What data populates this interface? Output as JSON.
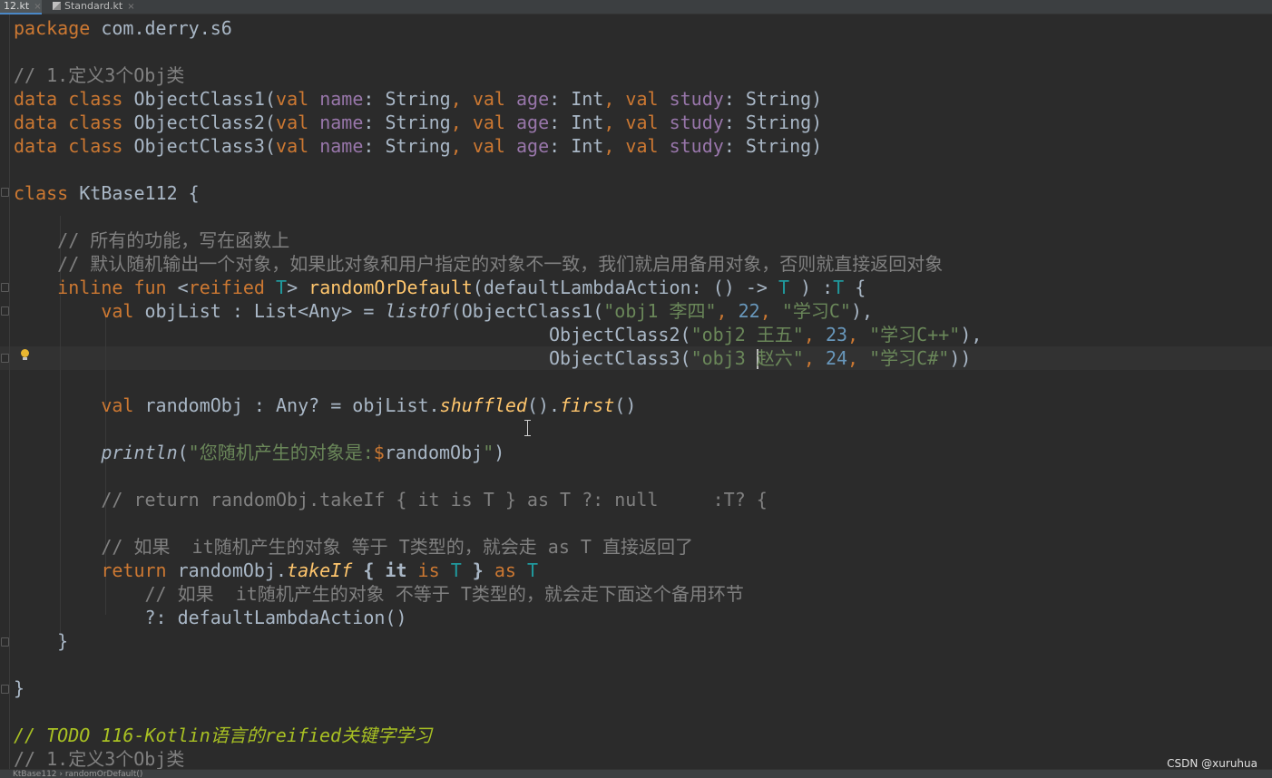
{
  "tabs": [
    {
      "label": "12.kt",
      "close": "×",
      "active": true
    },
    {
      "label": "Standard.kt",
      "close": "×",
      "active": false
    }
  ],
  "code": {
    "l1": {
      "kw": "package",
      "rest": " com.derry.s6"
    },
    "l2": {
      "comment": "// 1.定义3个Obj类"
    },
    "data_lines": [
      {
        "class_name": "ObjectClass1"
      },
      {
        "class_name": "ObjectClass2"
      },
      {
        "class_name": "ObjectClass3"
      }
    ],
    "data_tokens": {
      "data": "data",
      "class": "class",
      "val": "val",
      "name": "name",
      "age": "age",
      "study": "study",
      "string_type": "String",
      "int_type": "Int"
    },
    "class_decl": {
      "kw": "class",
      "name": " KtBase112 {"
    },
    "comment1": "// 所有的功能，写在函数上",
    "comment2": "// 默认随机输出一个对象，如果此对象和用户指定的对象不一致，我们就启用备用对象，否则就直接返回对象",
    "fun_decl": {
      "inline": "inline",
      "fun": "fun",
      "reified": "reified",
      "T": "T",
      "fn": "randomOrDefault",
      "params": "(defaultLambdaAction: () -> ",
      "ret": " ) :",
      "open": " {"
    },
    "objlist": {
      "val": "val",
      "decl": " objList : List<Any> = ",
      "listof": "listOf",
      "items": [
        {
          "cls": "ObjectClass1",
          "s1": "\"obj1 李四\"",
          "n": "22",
          "s2": "\"学习C\"",
          "end": "),"
        },
        {
          "cls": "ObjectClass2",
          "s1": "\"obj2 王五\"",
          "n": "23",
          "s2": "\"学习C++\"",
          "end": "),"
        },
        {
          "cls": "ObjectClass3",
          "s1a": "\"obj3 ",
          "s1b": "赵六\"",
          "n": "24",
          "s2": "\"学习C#\"",
          "end": "))"
        }
      ]
    },
    "randomobj": {
      "val": "val",
      "decl": " randomObj : Any? = objList.",
      "shuffled": "shuffled",
      "mid": "().",
      "first": "first",
      "end": "()"
    },
    "println": {
      "fn": "println",
      "open": "(",
      "s1": "\"您随机产生的对象是:",
      "dollar": "$",
      "var": "randomObj",
      "s2": "\"",
      "close": ")"
    },
    "comment3": "// return randomObj.takeIf { it is T } as T ?: null     :T? {",
    "comment4": "// 如果  it随机产生的对象 等于 T类型的，就会走 as T 直接返回了",
    "return_line": {
      "ret": "return",
      "obj": " randomObj.",
      "takeif": "takeIf",
      "brace_open": " { ",
      "it": "it",
      "is": "is",
      "T": "T",
      "brace_close": " } ",
      "as": "as"
    },
    "comment5": "// 如果  it随机产生的对象 不等于 T类型的，就会走下面这个备用环节",
    "elvis": "?: defaultLambdaAction()",
    "close_fun": "}",
    "close_class": "}",
    "todo": "// TODO 116-Kotlin语言的reified关键字学习",
    "comment6": "// 1.定义3个Obj类"
  },
  "statusbar": {
    "breadcrumb": "KtBase112  ›  randomOrDefault()"
  },
  "watermark": "CSDN @xuruhua",
  "colors": {
    "background": "#2b2b2b",
    "keyword": "#cc7832",
    "comment": "#808080",
    "property": "#9876aa",
    "string": "#6a8759",
    "number": "#6897bb",
    "function": "#ffc66d",
    "type_param": "#20999d",
    "todo": "#a8c023",
    "text": "#a9b7c6"
  }
}
